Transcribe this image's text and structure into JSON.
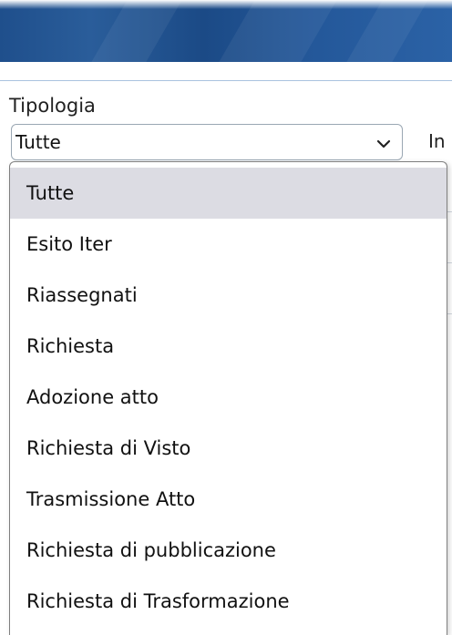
{
  "form": {
    "label": "Tipologia",
    "selected_value": "Tutte",
    "next_field_label_partial": "In"
  },
  "dropdown": {
    "options": [
      "Tutte",
      "Esito Iter",
      "Riassegnati",
      "Richiesta",
      "Adozione atto",
      "Richiesta di Visto",
      "Trasmissione Atto",
      "Richiesta di pubblicazione",
      "Richiesta di Trasformazione"
    ],
    "selected_index": 0
  },
  "icons": {
    "select_arrow": "chevron-down-icon"
  },
  "colors": {
    "banner": "#1f4f8c",
    "selected_option_bg": "#dcdce3",
    "divider": "#a9c3df"
  }
}
